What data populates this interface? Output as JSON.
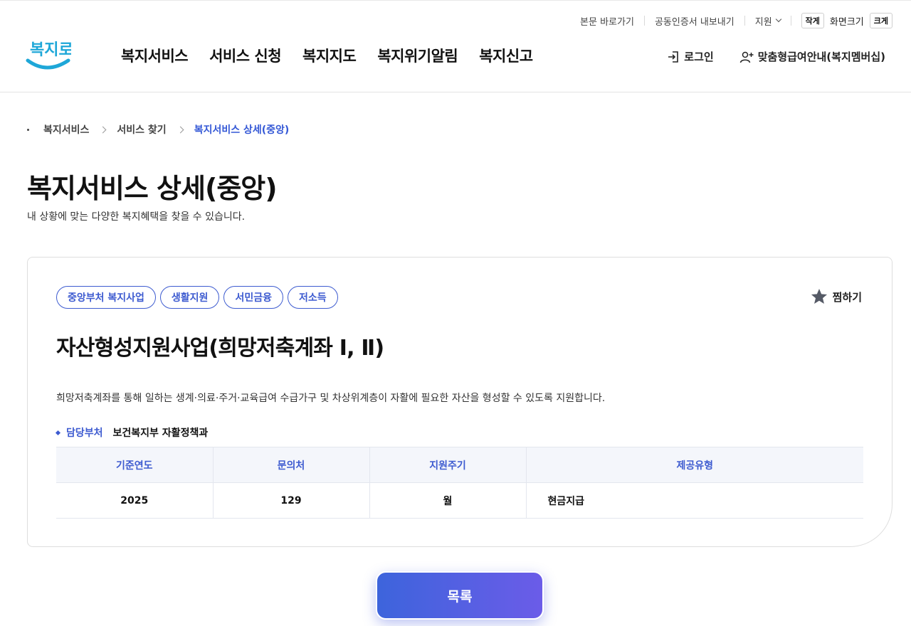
{
  "util": {
    "skip": "본문 바로가기",
    "cert": "공동인증서 내보내기",
    "support": "지원",
    "font_small": "작게",
    "font_label": "화면크기",
    "font_large": "크게"
  },
  "logo": {
    "text": "복지로"
  },
  "nav": {
    "items": [
      "복지서비스",
      "서비스 신청",
      "복지지도",
      "복지위기알림",
      "복지신고"
    ]
  },
  "header_right": {
    "login": "로그인",
    "membership": "맞춤형급여안내(복지멤버십)"
  },
  "breadcrumb": {
    "items": [
      "복지서비스",
      "서비스 찾기",
      "복지서비스 상세(중앙)"
    ]
  },
  "page": {
    "title": "복지서비스 상세(중앙)",
    "subtitle": "내 상황에 맞는 다양한 복지혜택을 찾을 수 있습니다."
  },
  "service": {
    "tags": [
      "중앙부처 복지사업",
      "생활지원",
      "서민금융",
      "저소득"
    ],
    "favorite": "찜하기",
    "title": "자산형성지원사업(희망저축계좌 Ⅰ, Ⅱ)",
    "description": "희망저축계좌를 통해 일하는 생계·의료·주거·교육급여 수급가구 및 차상위계층이 자활에 필요한 자산을 형성할 수 있도록 지원합니다.",
    "dept_label": "담당부처",
    "dept_value": "보건복지부 자활정책과",
    "table": {
      "headers": [
        "기준연도",
        "문의처",
        "지원주기",
        "제공유형"
      ],
      "row": [
        "2025",
        "129",
        "월",
        "현금지급"
      ]
    }
  },
  "actions": {
    "list": "목록"
  },
  "colors": {
    "accent": "#3d5bd0",
    "gradient_start": "#3d64dc",
    "gradient_end": "#6b5ce8"
  }
}
